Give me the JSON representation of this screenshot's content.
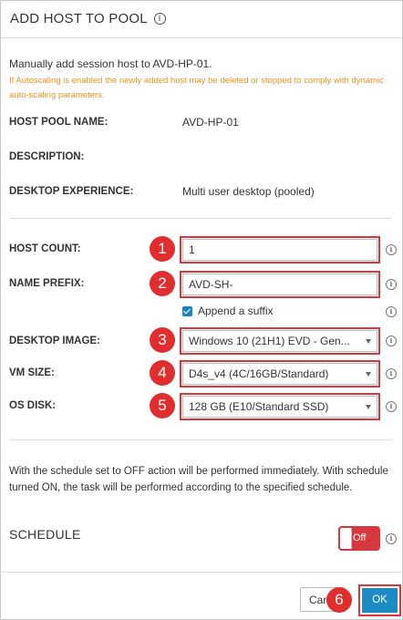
{
  "dialog": {
    "title": "ADD HOST TO POOL",
    "intro": "Manually add session host to AVD-HP-01.",
    "warning": "If Autoscaling is enabled the newly added host may be deleted or stopped to comply with dynamic auto-scaling parameters."
  },
  "details": [
    {
      "label": "HOST POOL NAME:",
      "value": "AVD-HP-01"
    },
    {
      "label": "DESCRIPTION:",
      "value": ""
    },
    {
      "label": "DESKTOP EXPERIENCE:",
      "value": "Multi user desktop (pooled)"
    }
  ],
  "form": {
    "host_count": {
      "label": "HOST COUNT:",
      "value": "1"
    },
    "name_prefix": {
      "label": "NAME PREFIX:",
      "value": "AVD-SH-"
    },
    "append_suffix": {
      "label": "Append a suffix",
      "checked": true
    },
    "desktop_image": {
      "label": "DESKTOP IMAGE:",
      "value": "Windows 10 (21H1) EVD - Gen..."
    },
    "vm_size": {
      "label": "VM SIZE:",
      "value": "D4s_v4 (4C/16GB/Standard)"
    },
    "os_disk": {
      "label": "OS DISK:",
      "value": "128 GB (E10/Standard SSD)"
    }
  },
  "schedule": {
    "note": "With the schedule set to OFF action will be performed immediately. With schedule turned ON, the task will be performed according to the specified schedule.",
    "label": "SCHEDULE",
    "toggle": "Off"
  },
  "footer": {
    "cancel": "Cancel",
    "ok": "OK"
  },
  "callouts": [
    "1",
    "2",
    "3",
    "4",
    "5",
    "6"
  ],
  "colors": {
    "highlight": "#d9373e",
    "callout": "#e02d2d",
    "primary": "#1e8cc4",
    "warning": "#e8911c"
  }
}
